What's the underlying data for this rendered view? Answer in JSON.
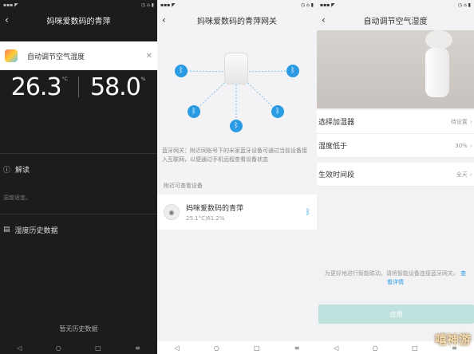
{
  "panel1": {
    "status_time": "",
    "status_right": "",
    "title": "妈咪爱数码的青萍",
    "card_title": "自动调节空气湿度",
    "temperature": "26.3",
    "temperature_unit": "°C",
    "humidity": "58.0",
    "humidity_unit": "%",
    "row1_label": "解读",
    "row1_note": "湿度适宜。",
    "row2_label": "湿度历史数据",
    "empty_text": "暂无历史数据"
  },
  "panel2": {
    "title": "妈咪爱数码的青萍网关",
    "description": "蓝牙网关：附近同账号下的米家蓝牙设备可通过当前设备接入互联网，以便通过手机远程查看设备状态",
    "section_label": "附近可查看设备",
    "device_name": "妈咪爱数码的青萍",
    "device_sub": "25.1°C|61.2%"
  },
  "panel3": {
    "title": "自动调节空气湿度",
    "rows": [
      {
        "label": "选择加湿器",
        "value": "待设置"
      },
      {
        "label": "湿度低于",
        "value": "30%"
      },
      {
        "label": "生效时间段",
        "value": "全天"
      }
    ],
    "hint_text": "为更好地进行智能联动，请将智能设备连接蓝牙网关。",
    "hint_link": "查看详情",
    "apply_label": "应用"
  },
  "watermark": "嘻神游",
  "colors": {
    "accent": "#2a9be3",
    "dark_bg": "#1c1c1e",
    "apply_btn": "#bfe2df"
  }
}
